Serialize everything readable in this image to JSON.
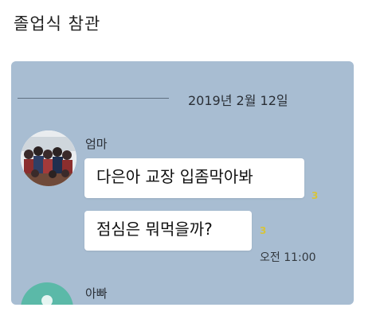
{
  "post": {
    "title": "졸업식 참관"
  },
  "chat": {
    "date_divider": "2019년 2월 12일",
    "messages": [
      {
        "sender": "엄마",
        "bubbles": [
          {
            "text": "다은아 교장 입좀막아봐",
            "unread": "3"
          },
          {
            "text": "점심은 뭐먹을까?",
            "unread": "3",
            "time": "오전 11:00"
          }
        ]
      },
      {
        "sender": "아빠"
      }
    ]
  },
  "colors": {
    "chat_background": "#a8bdd2",
    "bubble": "#ffffff",
    "unread_count": "#d7c43a",
    "dad_avatar": "#5bb9a8"
  },
  "icons": {
    "mom_avatar": "family-group-photo",
    "dad_avatar": "default-profile-icon"
  }
}
